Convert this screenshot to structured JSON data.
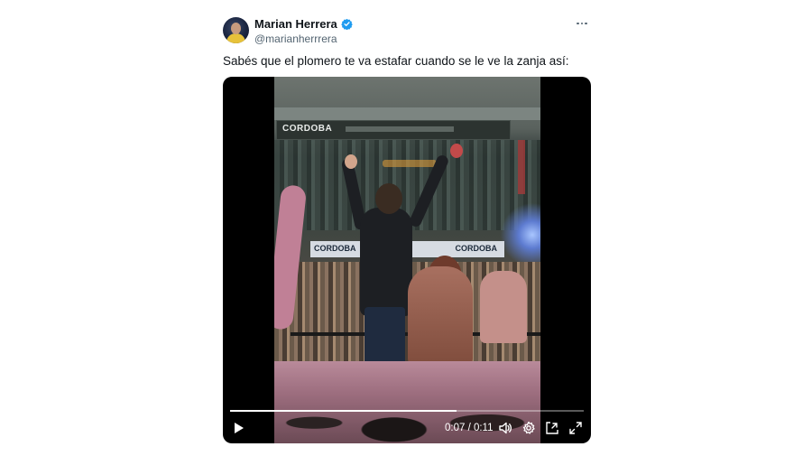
{
  "tweet": {
    "author_name": "Marian Herrera",
    "author_handle": "@marianherrrera",
    "verified": true,
    "text": "Sabés que el plomero te va estafar cuando se le ve la zanja así:"
  },
  "video": {
    "banner_top": "CORDOBA",
    "banner_mid_left": "CORDOBA",
    "banner_mid_right": "CORDOBA",
    "current_time": "0:07",
    "duration": "0:11",
    "time_display": "0:07 / 0:11",
    "progress": 0.64
  },
  "icons": {
    "more": "more-horizontal-icon",
    "verified": "verified-badge-icon",
    "play": "play-icon",
    "volume": "volume-icon",
    "settings": "gear-icon",
    "pip": "picture-in-picture-icon",
    "fullscreen": "fullscreen-icon"
  },
  "colors": {
    "verified_blue": "#1d9bf0",
    "text_primary": "#0f1419",
    "text_secondary": "#536471"
  }
}
